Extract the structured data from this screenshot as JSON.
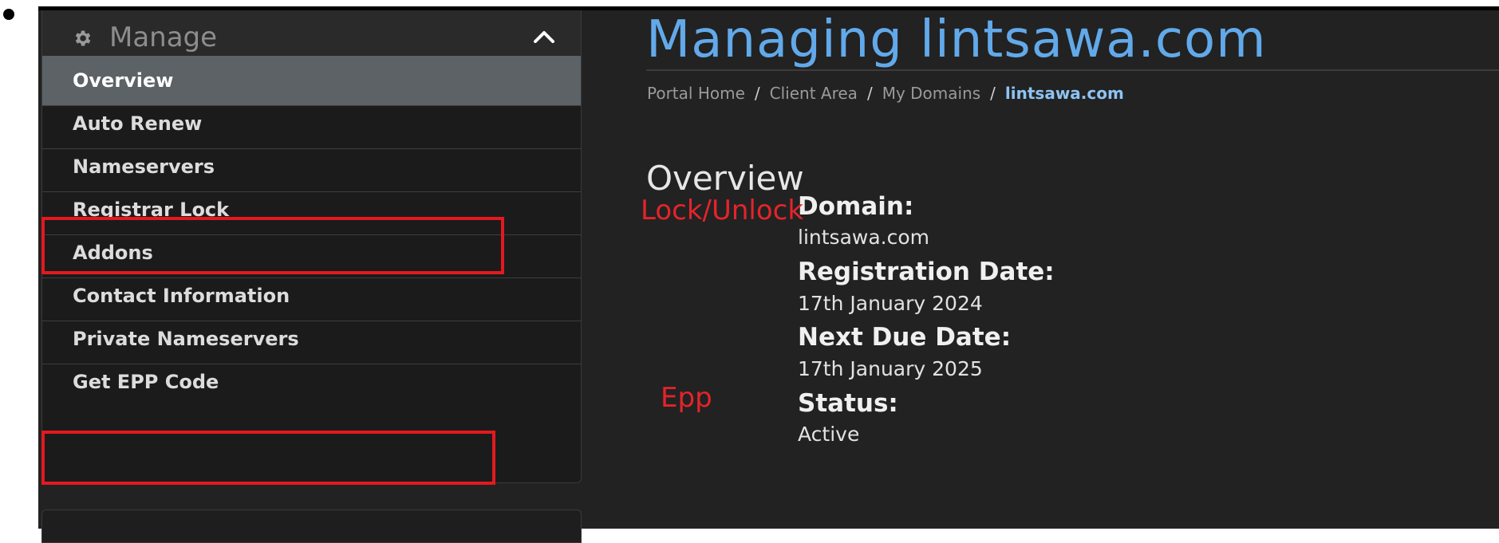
{
  "sidebar": {
    "header_label": "Manage",
    "items": [
      {
        "label": "Overview",
        "active": true
      },
      {
        "label": "Auto Renew",
        "active": false
      },
      {
        "label": "Nameservers",
        "active": false
      },
      {
        "label": "Registrar Lock",
        "active": false
      },
      {
        "label": "Addons",
        "active": false
      },
      {
        "label": "Contact Information",
        "active": false
      },
      {
        "label": "Private Nameservers",
        "active": false
      },
      {
        "label": "Get EPP Code",
        "active": false
      }
    ]
  },
  "main": {
    "title": "Managing lintsawa.com",
    "breadcrumb": [
      "Portal Home",
      "Client Area",
      "My Domains",
      "lintsawa.com"
    ],
    "breadcrumb_separator": "/",
    "section_title": "Overview",
    "fields": [
      {
        "label": "Domain:",
        "value": "lintsawa.com"
      },
      {
        "label": "Registration Date:",
        "value": "17th January 2024"
      },
      {
        "label": "Next Due Date:",
        "value": "17th January 2025"
      },
      {
        "label": "Status:",
        "value": "Active"
      }
    ]
  },
  "annotations": {
    "lock_unlock": "Lock/Unlock",
    "epp": "Epp",
    "color": "#e3191f"
  },
  "colors": {
    "background": "#222222",
    "title_blue": "#62a9ea",
    "active_item": "#5c6266"
  },
  "icons": {
    "header": "gear-icon",
    "collapse": "chevron-up-icon"
  }
}
